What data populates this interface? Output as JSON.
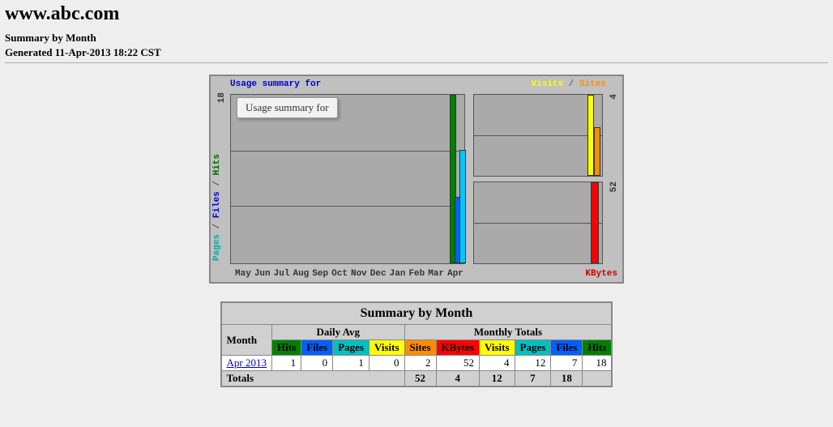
{
  "page": {
    "title": "www.abc.com",
    "subtitle1": "Summary by Month",
    "subtitle2": "Generated 11-Apr-2013 18:22 CST"
  },
  "chart": {
    "title": "Usage summary for",
    "tooltip": "Usage summary for",
    "legend_right": {
      "visits": "Visits",
      "sep": "/",
      "sites": "Sites"
    },
    "legend_left": {
      "pages": "Pages",
      "files": "Files",
      "hits": "Hits",
      "sep": " / "
    },
    "kbytes_label": "KBytes",
    "ytick_left": "18",
    "ytick_rt": "4",
    "ytick_rb": "52",
    "months": [
      "May",
      "Jun",
      "Jul",
      "Aug",
      "Sep",
      "Oct",
      "Nov",
      "Dec",
      "Jan",
      "Feb",
      "Mar",
      "Apr"
    ]
  },
  "chart_data": [
    {
      "type": "bar",
      "title": "Hits / Files / Pages by month",
      "categories": [
        "May",
        "Jun",
        "Jul",
        "Aug",
        "Sep",
        "Oct",
        "Nov",
        "Dec",
        "Jan",
        "Feb",
        "Mar",
        "Apr"
      ],
      "series": [
        {
          "name": "Hits",
          "color": "#008000",
          "values": [
            0,
            0,
            0,
            0,
            0,
            0,
            0,
            0,
            0,
            0,
            0,
            18
          ]
        },
        {
          "name": "Files",
          "color": "#0060ff",
          "values": [
            0,
            0,
            0,
            0,
            0,
            0,
            0,
            0,
            0,
            0,
            0,
            7
          ]
        },
        {
          "name": "Pages",
          "color": "#00c8ff",
          "values": [
            0,
            0,
            0,
            0,
            0,
            0,
            0,
            0,
            0,
            0,
            0,
            12
          ]
        }
      ],
      "ylabel": "",
      "ylim": [
        0,
        18
      ]
    },
    {
      "type": "bar",
      "title": "Visits / Sites (Apr)",
      "categories": [
        "Apr"
      ],
      "series": [
        {
          "name": "Visits",
          "color": "#ffff00",
          "values": [
            4
          ]
        },
        {
          "name": "Sites",
          "color": "#ff8c00",
          "values": [
            2
          ]
        }
      ],
      "ylim": [
        0,
        4
      ]
    },
    {
      "type": "bar",
      "title": "KBytes (Apr)",
      "categories": [
        "Apr"
      ],
      "series": [
        {
          "name": "KBytes",
          "color": "#ff0000",
          "values": [
            52
          ]
        }
      ],
      "ylim": [
        0,
        52
      ]
    }
  ],
  "table": {
    "title": "Summary by Month",
    "month_header": "Month",
    "daily_avg_header": "Daily Avg",
    "monthly_totals_header": "Monthly Totals",
    "col_hits": "Hits",
    "col_files": "Files",
    "col_pages": "Pages",
    "col_visits": "Visits",
    "col_sites": "Sites",
    "col_kbytes": "KBytes",
    "rows": [
      {
        "month": "Apr 2013",
        "daily": {
          "hits": 1,
          "files": 0,
          "pages": 1,
          "visits": 0
        },
        "monthly": {
          "sites": 2,
          "kbytes": 52,
          "visits": 4,
          "pages": 12,
          "files": 7,
          "hits": 18
        }
      }
    ],
    "totals_label": "Totals",
    "totals": {
      "kbytes": 52,
      "visits": 4,
      "pages": 12,
      "files": 7,
      "hits": 18
    }
  }
}
